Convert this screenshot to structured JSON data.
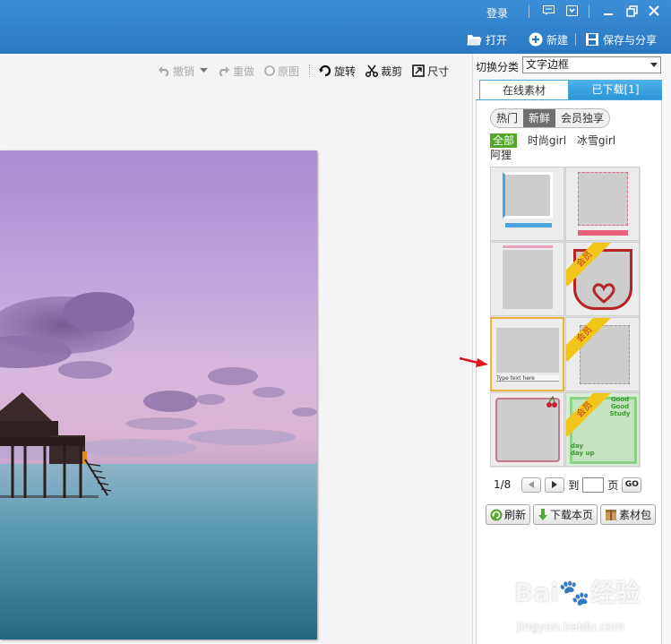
{
  "titlebar": {
    "login_label": "登录",
    "open_label": "打开",
    "new_label": "新建",
    "save_share_label": "保存与分享",
    "accent_color": "#2a78c2"
  },
  "toolbar": {
    "undo_label": "撤销",
    "redo_label": "重做",
    "original_label": "原图",
    "rotate_label": "旋转",
    "crop_label": "裁剪",
    "size_label": "尺寸"
  },
  "panel": {
    "category_label": "切换分类",
    "category_value": "文字边框",
    "tabs": [
      {
        "label": "在线素材"
      },
      {
        "label": "已下载[1]"
      }
    ],
    "filters": [
      {
        "label": "热门"
      },
      {
        "label": "新鲜"
      },
      {
        "label": "会员独享"
      }
    ],
    "tags": [
      {
        "label": "全部"
      },
      {
        "label": "时尚girl"
      },
      {
        "label": "冰雪girl"
      },
      {
        "label": "阿狸"
      }
    ],
    "member_badge": "会员",
    "thumb_texts": {
      "good_good_study": "Good Good Study",
      "day_day_up": "day day up",
      "text_here": "Type text here"
    },
    "pager": {
      "page_status": "1/8",
      "goto_label": "到",
      "page_unit": "页",
      "go_label": "GO"
    },
    "actions": [
      {
        "label": "刷新"
      },
      {
        "label": "下载本页"
      },
      {
        "label": "素材包"
      }
    ]
  },
  "watermark": {
    "text": "Bai",
    "text2": "经验",
    "url": "jingyan.baidu.com"
  }
}
